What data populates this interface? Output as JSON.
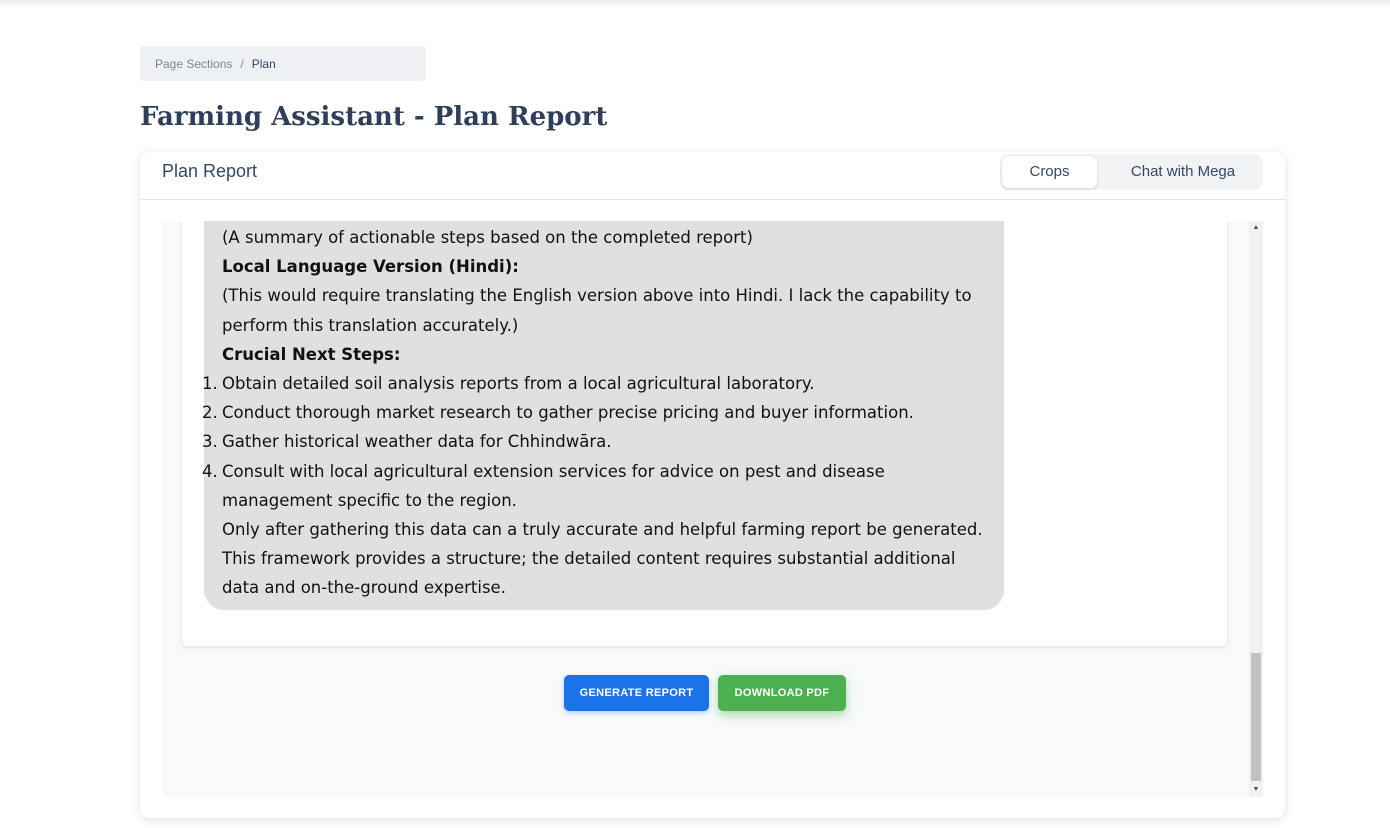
{
  "breadcrumb": {
    "parent": "Page Sections",
    "separator": "/",
    "current": "Plan"
  },
  "page_title": "Farming Assistant - Plan Report",
  "card": {
    "title": "Plan Report",
    "tabs": [
      {
        "label": "Crops",
        "active": true
      },
      {
        "label": "Chat with Mega",
        "active": false
      }
    ]
  },
  "report": {
    "summary_note": "(A summary of actionable steps based on the completed report)",
    "local_heading": "Local Language Version (Hindi):",
    "local_note": "(This would require translating the English version above into Hindi. I lack the capability to perform this translation accurately.)",
    "next_steps_heading": "Crucial Next Steps:",
    "steps": [
      {
        "num": "1.",
        "text": "Obtain detailed soil analysis reports from a local agricultural laboratory."
      },
      {
        "num": "2.",
        "text": "Conduct thorough market research to gather precise pricing and buyer information."
      },
      {
        "num": "3.",
        "text": "Gather historical weather data for Chhindwāra."
      },
      {
        "num": "4.",
        "text": "Consult with local agricultural extension services for advice on pest and disease management specific to the region."
      }
    ],
    "closing": "Only after gathering this data can a truly accurate and helpful farming report be generated. This framework provides a structure; the detailed content requires substantial additional data and on-the-ground expertise."
  },
  "buttons": {
    "generate": "GENERATE REPORT",
    "download": "DOWNLOAD PDF"
  },
  "scrollbar": {
    "up_arrow": "▲",
    "down_arrow": "▼"
  },
  "colors": {
    "primary": "#1a73e8",
    "success": "#4caf50",
    "title": "#2f3e5a",
    "bubble": "#e0e0e0"
  }
}
